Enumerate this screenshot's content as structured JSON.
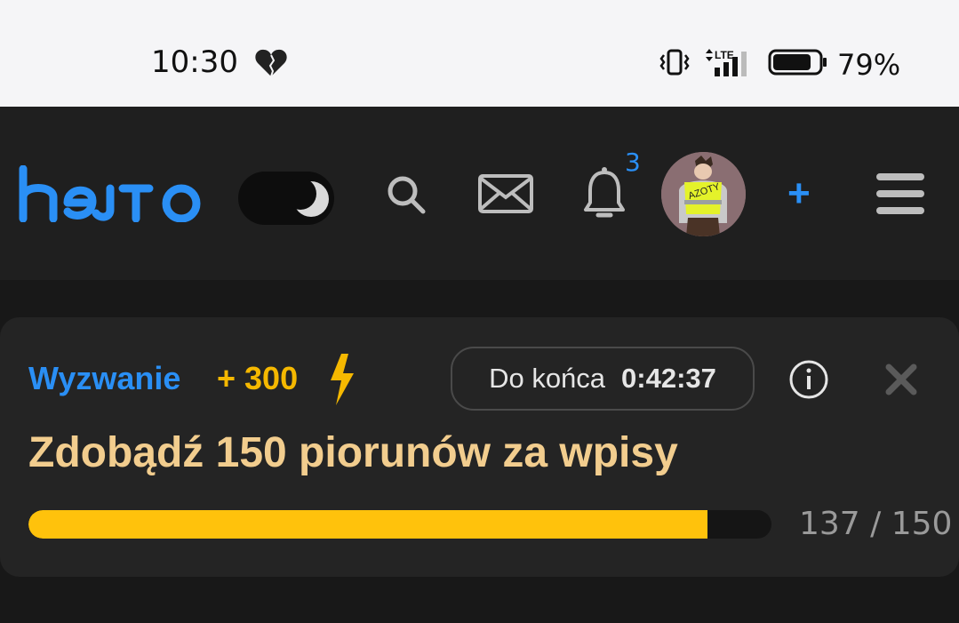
{
  "status_bar": {
    "time": "10:30",
    "battery_percent": "79%",
    "battery_level": 0.79,
    "network": "LTE",
    "icons": [
      "heart-icon",
      "vibrate-icon",
      "lte-signal-icon",
      "battery-icon"
    ]
  },
  "header": {
    "logo_text": "hejto",
    "notification_count": "3",
    "avatar_text": "AZOTY",
    "plus_label": "+",
    "colors": {
      "accent": "#2a8ff5",
      "background": "#1f1f1f"
    }
  },
  "challenge": {
    "label": "Wyzwanie",
    "points": "+ 300",
    "timer_label": "Do końca",
    "timer_value": "0:42:37",
    "title": "Zdobądź 150 piorunów za wpisy",
    "progress_text": "137 / 150",
    "progress_current": 137,
    "progress_total": 150,
    "colors": {
      "points": "#f5b800",
      "title": "#f2cd8e",
      "bar": "#ffc20c"
    }
  }
}
